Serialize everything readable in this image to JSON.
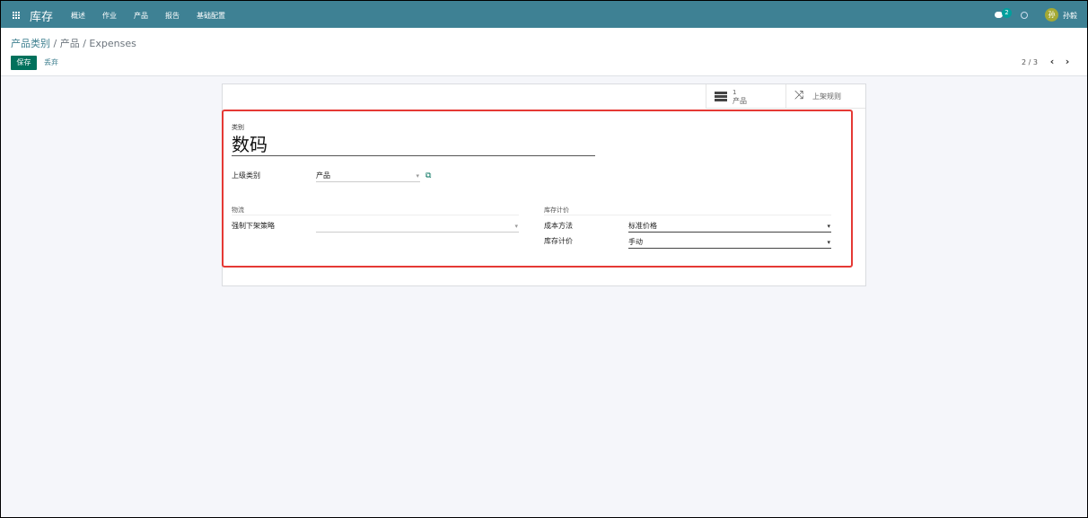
{
  "navbar": {
    "brand": "库存",
    "menu": [
      "概述",
      "作业",
      "产品",
      "报告",
      "基础配置"
    ],
    "chat_count": "2",
    "avatar_initial": "孙",
    "username": "孙毅",
    "icons": [
      "apps-grid-icon",
      "chat-icon",
      "clock-icon"
    ],
    "color": "#3e8194"
  },
  "breadcrumb": {
    "root": "产品类别",
    "sep1": " / ",
    "middle": "产品",
    "sep2": " / ",
    "current": "Expenses"
  },
  "toolbar": {
    "save_label": "保存",
    "discard_label": "丢弃"
  },
  "pager": {
    "value": "2 / 3"
  },
  "smart_buttons": {
    "products_count": "1",
    "products_label": "产品",
    "putaway_label": "上架规则"
  },
  "form": {
    "name_label": "类别",
    "name_value": "数码",
    "parent_label": "上级类别",
    "parent_value": "产品",
    "logistics_section": "物流",
    "removal_label": "强制下架策略",
    "removal_value": "",
    "valuation_section": "库存计价",
    "cost_method_label": "成本方法",
    "cost_method_value": "标准价格",
    "valuation_label": "库存计价",
    "valuation_value": "手动"
  },
  "colors": {
    "primary_button": "#00715c",
    "highlight_border": "#e53935",
    "link": "#3e7f8f"
  }
}
